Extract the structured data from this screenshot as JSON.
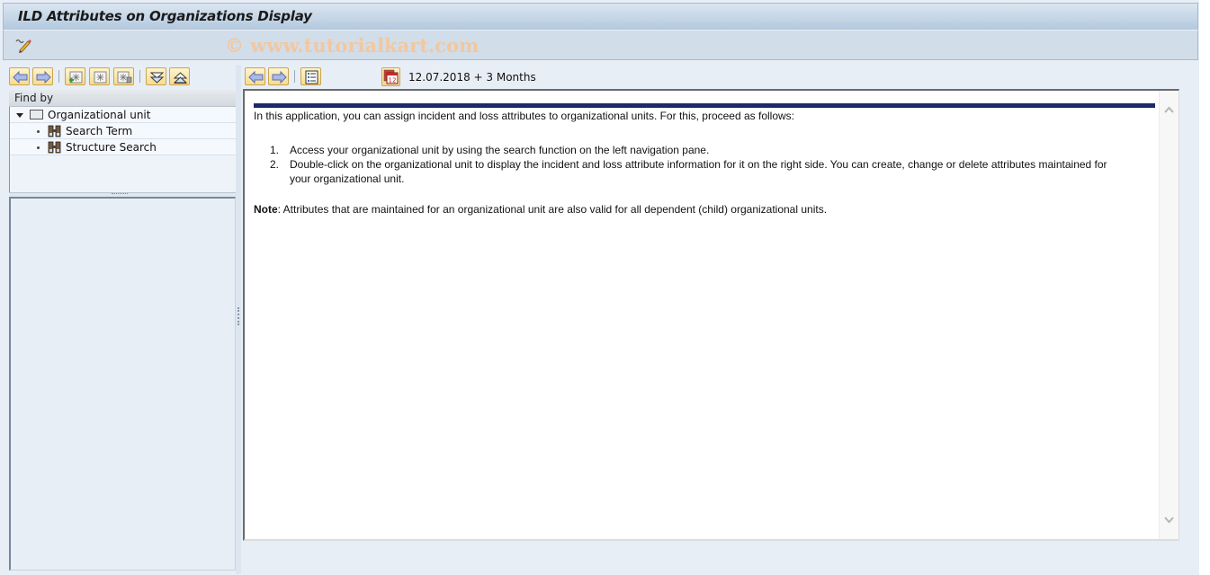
{
  "window": {
    "title": "ILD Attributes on Organizations Display",
    "watermark": "© www.tutorialkart.com"
  },
  "app_toolbar": {
    "icons": [
      "display-change-icon"
    ]
  },
  "left_pane": {
    "toolbar_icons": [
      "arrow-left-icon",
      "arrow-right-icon",
      "add-node-icon",
      "node-icon",
      "delete-node-icon",
      "expand-all-icon",
      "collapse-all-icon"
    ],
    "find_by_header": "Find by",
    "tree": {
      "root": {
        "label": "Organizational unit",
        "expanded": true
      },
      "children": [
        {
          "label": "Search Term",
          "icon": "binoculars-icon"
        },
        {
          "label": "Structure Search",
          "icon": "binoculars-icon"
        }
      ]
    }
  },
  "right_pane": {
    "toolbar_icons": [
      "arrow-left-icon",
      "arrow-right-icon",
      "list-details-icon"
    ],
    "calendar_icon": "calendar-icon",
    "date_range": "12.07.2018  + 3 Months",
    "document": {
      "intro": "In this application, you can assign incident and loss attributes to organizational units. For this, proceed as follows:",
      "steps": [
        {
          "num": "1.",
          "text": "Access your organizational unit by using the search function on the left navigation pane."
        },
        {
          "num": "2.",
          "text": "Double-click on the organizational unit to display the incident and loss attribute information for it on the right side. You can create, change or delete attributes maintained for your organizational unit."
        }
      ],
      "note_label": "Note",
      "note_text": ": Attributes that are maintained for an organizational unit are also valid for all dependent (child) organizational units."
    },
    "colors": {
      "accent_bar": "#1b2a6b"
    }
  }
}
